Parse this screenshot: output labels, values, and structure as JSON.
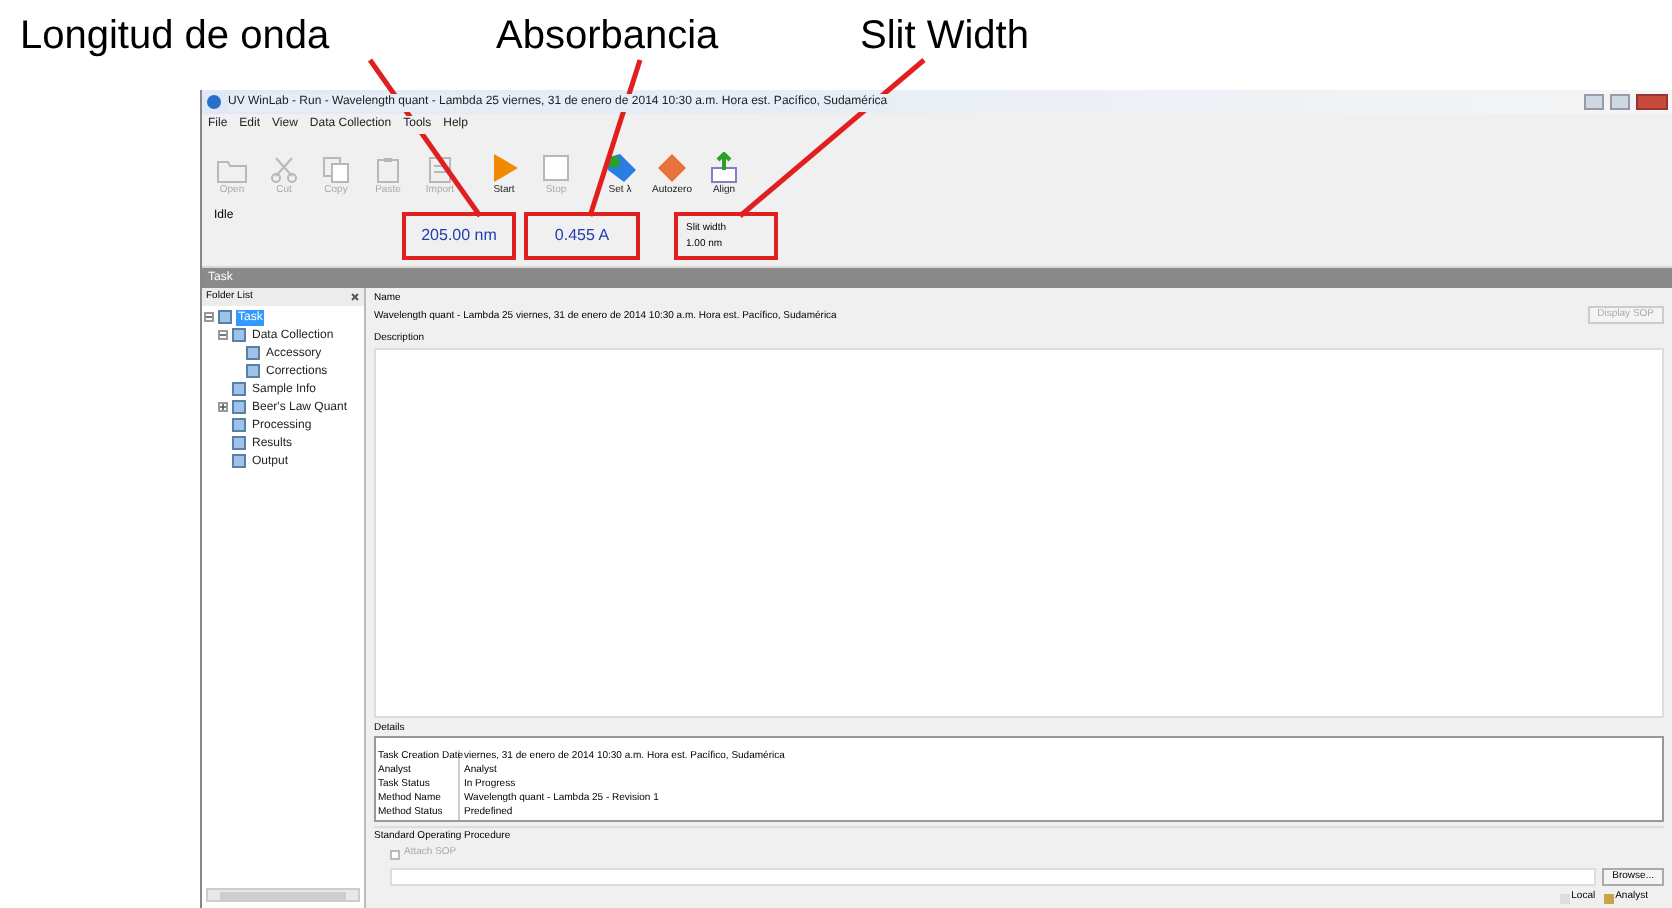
{
  "annotations": [
    {
      "label": "Longitud de onda"
    },
    {
      "label": "Absorbancia"
    },
    {
      "label": "Slit Width"
    }
  ],
  "window": {
    "title": "UV WinLab - Run - Wavelength quant - Lambda 25 viernes, 31 de enero de 2014 10:30 a.m. Hora est. Pacífico, Sudamérica"
  },
  "menu": [
    "File",
    "Edit",
    "View",
    "Data Collection",
    "Tools",
    "Help"
  ],
  "toolbar": [
    {
      "kind": "open",
      "label": "Open",
      "disabled": true
    },
    {
      "kind": "cut",
      "label": "Cut",
      "disabled": true
    },
    {
      "kind": "copy",
      "label": "Copy",
      "disabled": true
    },
    {
      "kind": "paste",
      "label": "Paste",
      "disabled": true
    },
    {
      "kind": "import",
      "label": "Import",
      "disabled": true
    },
    {
      "kind": "start",
      "label": "Start",
      "disabled": false
    },
    {
      "kind": "stop",
      "label": "Stop",
      "disabled": true
    },
    {
      "kind": "setl",
      "label": "Set λ",
      "disabled": false
    },
    {
      "kind": "autozero",
      "label": "Autozero",
      "disabled": false
    },
    {
      "kind": "align",
      "label": "Align",
      "disabled": false
    }
  ],
  "instrument": {
    "status": "Idle",
    "wavelength": "205.00 nm",
    "absorbance": "0.455 A",
    "slit_label": "Slit width",
    "slit_value": "1.00 nm"
  },
  "task_bar": "Task",
  "folder_list": {
    "title": "Folder List",
    "items": [
      {
        "label": "Task",
        "selected": true,
        "expanded": true,
        "children": [
          {
            "label": "Data Collection",
            "selected": false,
            "expanded": true,
            "children": [
              {
                "label": "Accessory",
                "selected": false
              },
              {
                "label": "Corrections",
                "selected": false
              }
            ]
          },
          {
            "label": "Sample Info",
            "selected": false
          },
          {
            "label": "Beer's Law Quant",
            "selected": false,
            "expanded": false
          },
          {
            "label": "Processing",
            "selected": false
          },
          {
            "label": "Results",
            "selected": false
          },
          {
            "label": "Output",
            "selected": false
          }
        ]
      }
    ]
  },
  "name_label": "Name",
  "name_value": "Wavelength quant - Lambda 25 viernes, 31 de enero de 2014 10:30 a.m. Hora est. Pacífico, Sudamérica",
  "display_sop": "Display SOP",
  "description_label": "Description",
  "details": {
    "title": "Details",
    "rows": [
      [
        "Task Creation Date",
        "viernes, 31 de enero de 2014 10:30 a.m. Hora est. Pacífico, Sudamérica"
      ],
      [
        "Analyst",
        "Analyst"
      ],
      [
        "Task Status",
        "In Progress"
      ],
      [
        "Method Name",
        "Wavelength quant - Lambda 25 - Revision 1"
      ],
      [
        "Method Status",
        "Predefined"
      ]
    ]
  },
  "sop": {
    "title": "Standard Operating Procedure",
    "attach_label": "Attach SOP",
    "attach_checked": false,
    "browse": "Browse..."
  },
  "status_bar": [
    "Local",
    "Analyst"
  ]
}
